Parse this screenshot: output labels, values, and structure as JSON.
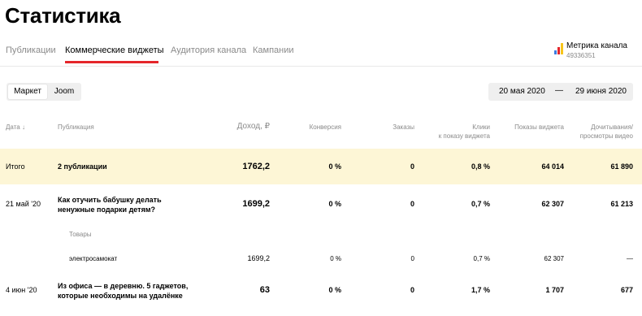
{
  "page": {
    "title": "Статистика"
  },
  "tabs": [
    {
      "label": "Публикации",
      "active": false
    },
    {
      "label": "Коммерческие виджеты",
      "active": true
    },
    {
      "label": "Аудитория канала",
      "active": false
    },
    {
      "label": "Кампании",
      "active": false
    }
  ],
  "metrika": {
    "title": "Метрика канала",
    "id": "49336351",
    "icon": "metrika-logo-icon"
  },
  "segments": [
    {
      "label": "Маркет",
      "active": true
    },
    {
      "label": "Joom",
      "active": false
    }
  ],
  "daterange": {
    "from": "20 мая 2020",
    "dash": "—",
    "to": "29 июня 2020"
  },
  "table": {
    "headers": {
      "date": "Дата ↓",
      "publication": "Публикация",
      "income": "Доход, ₽",
      "conversion": "Конверсия",
      "orders": "Заказы",
      "clicks_1": "Клики",
      "clicks_2": "к показу виджета",
      "impressions": "Показы виджета",
      "views_1": "Дочитывания/",
      "views_2": "просмотры видео"
    },
    "total": {
      "date": "Итого",
      "publication": "2 публикации",
      "income": "1762,2",
      "conversion": "0 %",
      "orders": "0",
      "clicks": "0,8 %",
      "impressions": "64 014",
      "views": "61 890"
    },
    "rows": [
      {
        "date": "21 май '20",
        "publication": "Как отучить бабушку делать ненужные подарки детям?",
        "income": "1699,2",
        "conversion": "0 %",
        "orders": "0",
        "clicks": "0,7 %",
        "impressions": "62 307",
        "views": "61 213"
      },
      {
        "date": "4 июн '20",
        "publication": "Из офиса — в деревню. 5 гаджетов, которые необходимы на удалёнке",
        "income": "63",
        "conversion": "0 %",
        "orders": "0",
        "clicks": "1,7 %",
        "impressions": "1 707",
        "views": "677"
      }
    ],
    "goods": {
      "label": "Товары",
      "item": {
        "name": "электросамокат",
        "income": "1699,2",
        "conversion": "0 %",
        "orders": "0",
        "clicks": "0,7 %",
        "impressions": "62 307",
        "views": "—"
      }
    }
  },
  "colors": {
    "accent": "#e5262a",
    "total_bg": "#fdf6d6",
    "muted_text": "#8a8a8a"
  }
}
